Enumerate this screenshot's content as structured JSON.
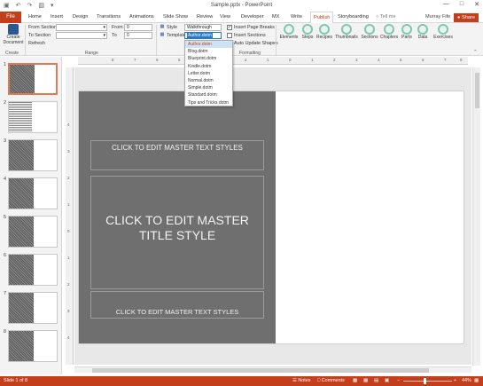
{
  "window": {
    "title": "Sample.pptx - PowerPoint",
    "qat_icons": [
      "save-icon",
      "undo-icon",
      "redo-icon",
      "present-icon",
      "customize-icon"
    ],
    "controls": [
      "minimize-icon",
      "restore-icon",
      "close-icon"
    ]
  },
  "tabs": {
    "file": "File",
    "items": [
      "Home",
      "Insert",
      "Design",
      "Transitions",
      "Animations",
      "Slide Show",
      "Review",
      "View",
      "Developer",
      "MX",
      "Write",
      "Publish",
      "Storyboarding"
    ],
    "active": "Publish",
    "tell_me": "Tell me",
    "user": "Murray Fife",
    "share": "Share"
  },
  "ribbon": {
    "create": {
      "button": "Create Document",
      "group": "Create"
    },
    "range": {
      "from_section": "From Section",
      "to_section": "To Section",
      "refresh": "Refresh",
      "from_label": "From",
      "from_value": "0",
      "to_label": "To",
      "to_value": "0",
      "group": "Range"
    },
    "formatting": {
      "style_label": "Style",
      "style_value": "Walkthrough",
      "template_label": "Template",
      "template_value": "Author.dotm",
      "insert_page_breaks": "Insert Page Breaks",
      "insert_page_breaks_checked": true,
      "insert_sections": "Insert Sections",
      "insert_sections_checked": false,
      "auto_update_shapes": "Auto Update Shapes",
      "group": "Formatting"
    },
    "buttons": [
      "Elements",
      "Steps",
      "Recipes",
      "Thumbnails",
      "Sections",
      "Chapters",
      "Parts",
      "Data",
      "Exercises"
    ]
  },
  "template_dropdown": {
    "options": [
      "Author.dotm",
      "Blog.dotm",
      "Blueprint.dotm",
      "Kindle.dotm",
      "Letter.dotm",
      "Normal.dotm",
      "Simple.dotm",
      "Standard.dotm",
      "Tips and Tricks.dotm"
    ],
    "selected": "Author.dotm"
  },
  "ruler": {
    "h_ticks": [
      "8",
      "7",
      "6",
      "5",
      "4",
      "3",
      "2",
      "1",
      "0",
      "1",
      "2",
      "3",
      "4",
      "5",
      "6",
      "7",
      "8"
    ],
    "v_ticks": [
      "4",
      "3",
      "2",
      "1",
      "0",
      "1",
      "2",
      "3",
      "4"
    ]
  },
  "thumbnails": [
    "1",
    "2",
    "3",
    "4",
    "5",
    "6",
    "7",
    "8"
  ],
  "slide": {
    "top_text": "CLICK TO EDIT MASTER TEXT STYLES",
    "title_line1": "CLICK TO EDIT MASTER",
    "title_line2": "TITLE STYLE",
    "bottom_text": "CLICK TO EDIT MASTER TEXT STYLES"
  },
  "status": {
    "slide_info": "Slide 1 of 8",
    "notes": "Notes",
    "comments": "Comments",
    "zoom": "44%"
  },
  "colors": {
    "accent": "#c43e1c",
    "master_bg": "#6f6f6f",
    "selected_thumb": "#e07a55"
  }
}
